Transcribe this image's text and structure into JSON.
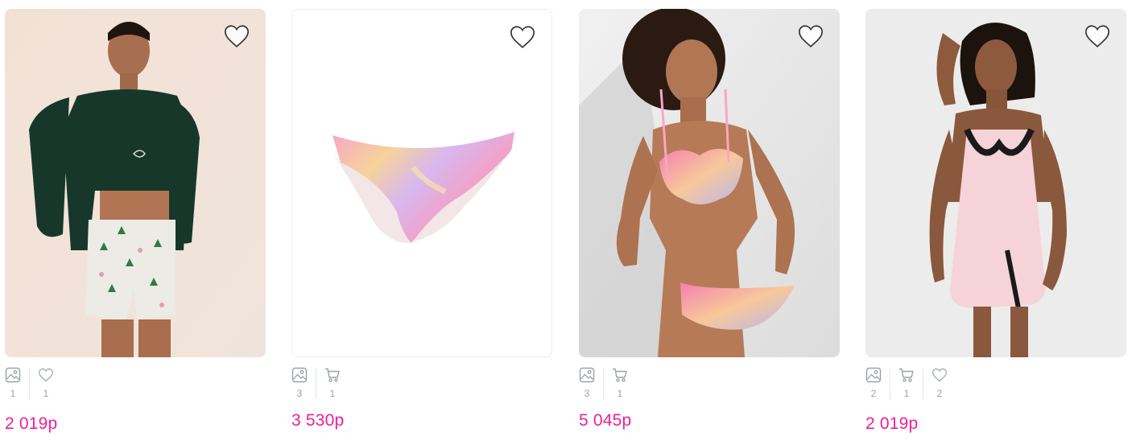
{
  "products": [
    {
      "id": "p1",
      "price": "2 019р",
      "stats": {
        "photos": "1",
        "likes": "1"
      }
    },
    {
      "id": "p2",
      "price": "3 530р",
      "stats": {
        "photos": "3",
        "carts": "1"
      }
    },
    {
      "id": "p3",
      "price": "5 045р",
      "stats": {
        "photos": "3",
        "carts": "1"
      }
    },
    {
      "id": "p4",
      "price": "2 019р",
      "stats": {
        "photos": "2",
        "carts": "1",
        "likes": "2"
      }
    }
  ],
  "colors": {
    "price": "#ec1f9a",
    "icon": "#9aa1ab",
    "divider": "#e3e6ea"
  },
  "icons": {
    "favorite": "heart-outline-icon",
    "photos": "image-icon",
    "carts": "cart-icon",
    "likes": "heart-icon"
  }
}
